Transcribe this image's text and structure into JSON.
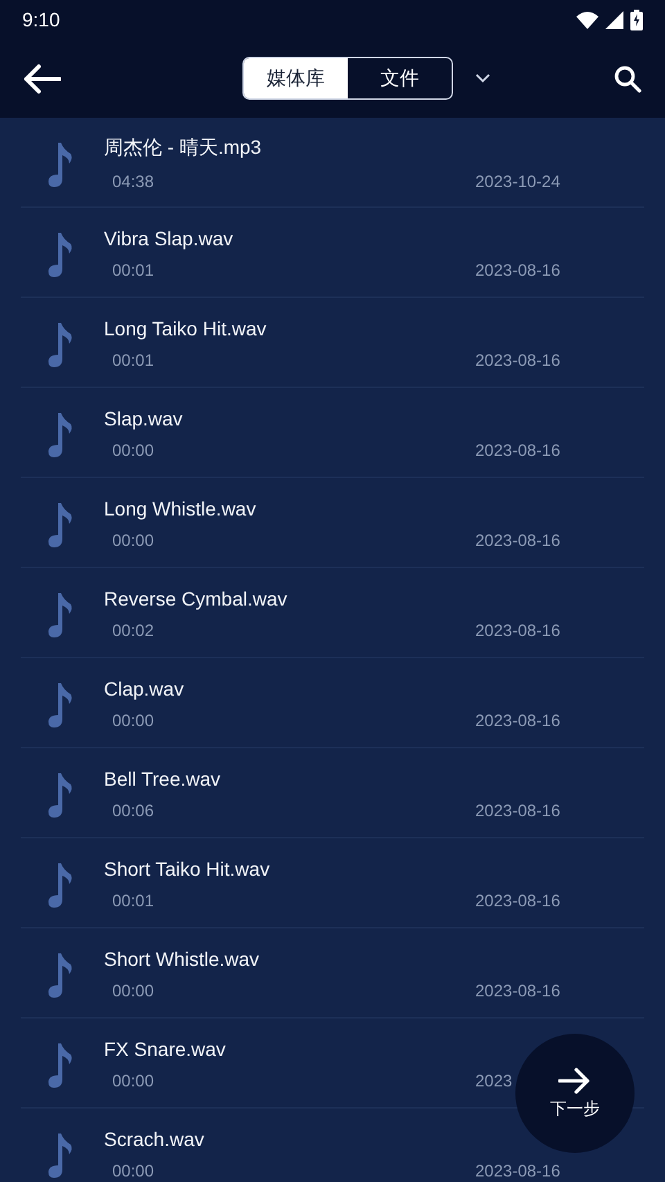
{
  "status_bar": {
    "time": "9:10"
  },
  "header": {
    "tabs": [
      {
        "label": "媒体库",
        "selected": true
      },
      {
        "label": "文件",
        "selected": false
      }
    ]
  },
  "files": [
    {
      "name": "周杰伦 - 晴天.mp3",
      "duration": "04:38",
      "date": "2023-10-24"
    },
    {
      "name": "Vibra Slap.wav",
      "duration": "00:01",
      "date": "2023-08-16"
    },
    {
      "name": "Long Taiko Hit.wav",
      "duration": "00:01",
      "date": "2023-08-16"
    },
    {
      "name": "Slap.wav",
      "duration": "00:00",
      "date": "2023-08-16"
    },
    {
      "name": "Long Whistle.wav",
      "duration": "00:00",
      "date": "2023-08-16"
    },
    {
      "name": "Reverse Cymbal.wav",
      "duration": "00:02",
      "date": "2023-08-16"
    },
    {
      "name": "Clap.wav",
      "duration": "00:00",
      "date": "2023-08-16"
    },
    {
      "name": "Bell Tree.wav",
      "duration": "00:06",
      "date": "2023-08-16"
    },
    {
      "name": "Short Taiko Hit.wav",
      "duration": "00:01",
      "date": "2023-08-16"
    },
    {
      "name": "Short Whistle.wav",
      "duration": "00:00",
      "date": "2023-08-16"
    },
    {
      "name": "FX Snare.wav",
      "duration": "00:00",
      "date": "2023"
    },
    {
      "name": "Scrach.wav",
      "duration": "00:00",
      "date": "2023-08-16"
    }
  ],
  "next_button": {
    "label": "下一步"
  }
}
